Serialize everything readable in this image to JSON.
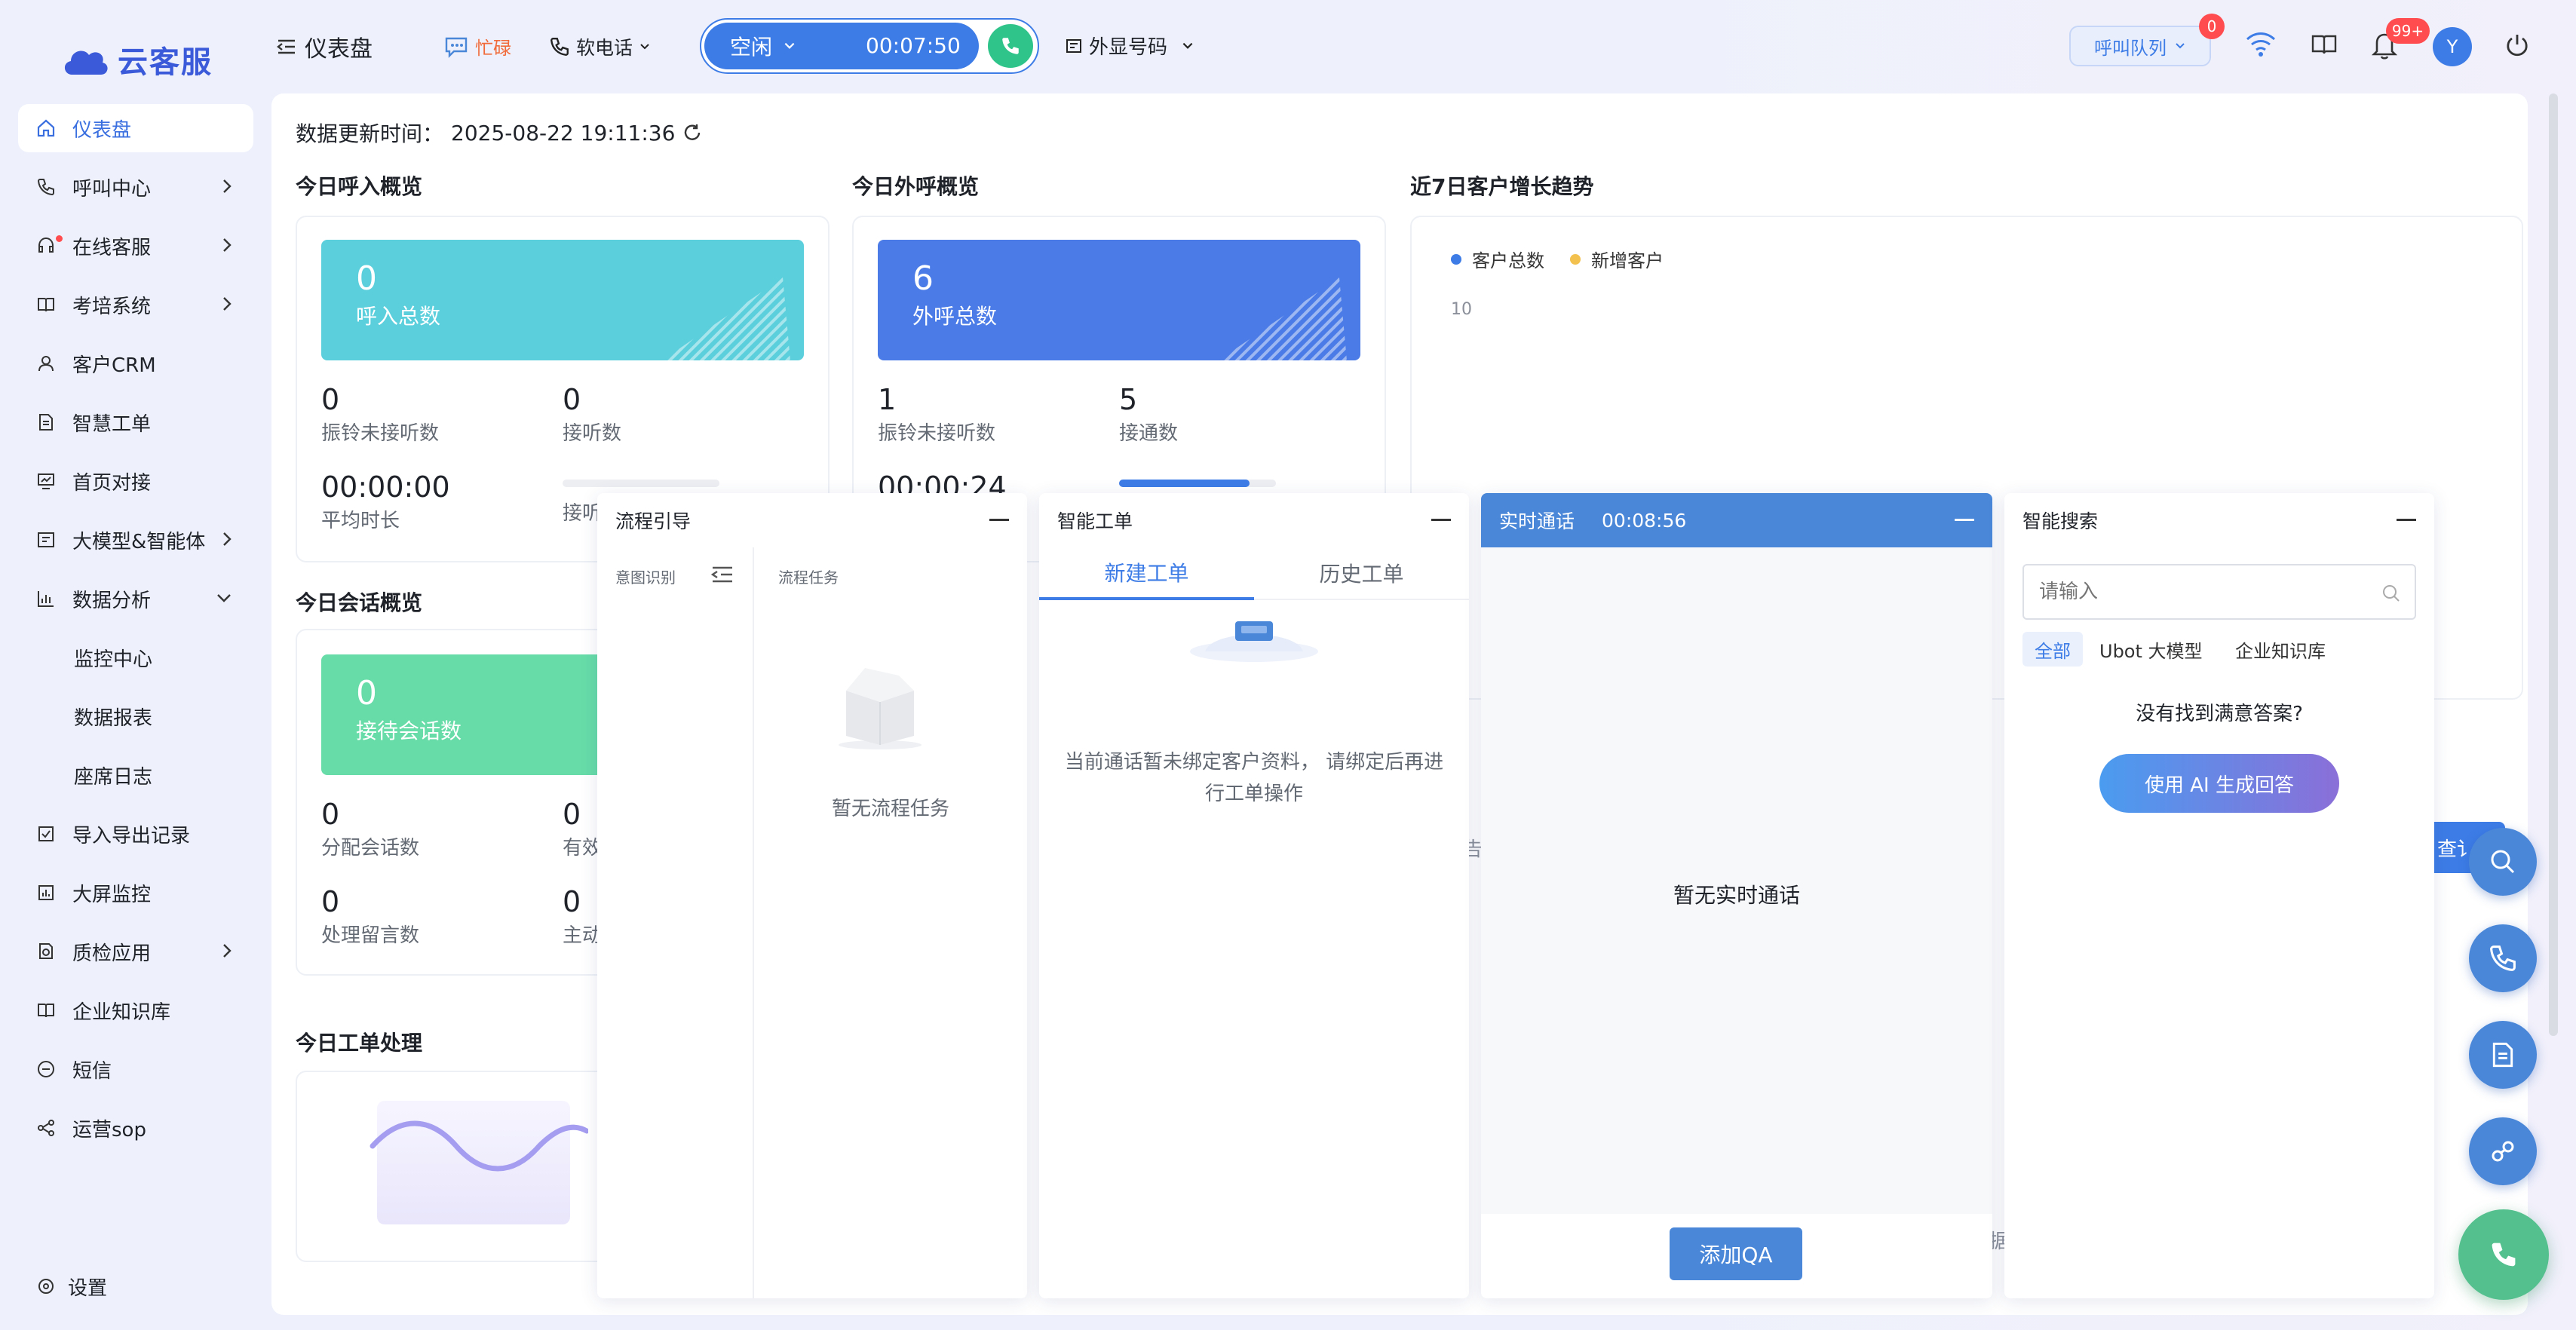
{
  "app": {
    "name": "云客服"
  },
  "header": {
    "title": "仪表盘",
    "busy_label": "忙碌",
    "softphone_label": "软电话",
    "status_label": "空闲",
    "status_timer": "00:07:50",
    "outbound_number_label": "外显号码",
    "queue_label": "呼叫队列",
    "queue_badge": "0",
    "notification_badge": "99+",
    "avatar_initial": "Y"
  },
  "sidebar": {
    "items": [
      {
        "label": "仪表盘"
      },
      {
        "label": "呼叫中心"
      },
      {
        "label": "在线客服"
      },
      {
        "label": "考培系统"
      },
      {
        "label": "客户CRM"
      },
      {
        "label": "智慧工单"
      },
      {
        "label": "首页对接"
      },
      {
        "label": "大模型&智能体"
      },
      {
        "label": "数据分析"
      },
      {
        "label": "监控中心"
      },
      {
        "label": "数据报表"
      },
      {
        "label": "座席日志"
      },
      {
        "label": "导入导出记录"
      },
      {
        "label": "大屏监控"
      },
      {
        "label": "质检应用"
      },
      {
        "label": "企业知识库"
      },
      {
        "label": "短信"
      },
      {
        "label": "运营sop"
      },
      {
        "label": "设置"
      }
    ]
  },
  "dashboard": {
    "update_label": "数据更新时间：",
    "update_time": "2025-08-22 19:11:36",
    "inbound": {
      "title": "今日呼入概览",
      "kpi_value": "0",
      "kpi_label": "呼入总数",
      "stats": [
        {
          "value": "0",
          "label": "振铃未接听数"
        },
        {
          "value": "0",
          "label": "接听数"
        },
        {
          "value": "00:00:00",
          "label": "平均时长"
        },
        {
          "value": "",
          "label": "接听"
        }
      ],
      "answer_rate": 0
    },
    "outbound": {
      "title": "今日外呼概览",
      "kpi_value": "6",
      "kpi_label": "外呼总数",
      "stats": [
        {
          "value": "1",
          "label": "振铃未接听数"
        },
        {
          "value": "5",
          "label": "接通数"
        },
        {
          "value": "00:00:24",
          "label": ""
        }
      ],
      "connect_rate": 0.83
    },
    "trend": {
      "title": "近7日客户增长趋势",
      "legend": [
        {
          "label": "客户总数",
          "color": "#3d7ce6"
        },
        {
          "label": "新增客户",
          "color": "#f2c14e"
        }
      ],
      "y_tick": "10"
    },
    "sessions": {
      "title": "今日会话概览",
      "kpi_value": "0",
      "kpi_label": "接待会话数",
      "stats": [
        {
          "value": "0",
          "label": "分配会话数"
        },
        {
          "value": "0",
          "label": "有效"
        },
        {
          "value": "0",
          "label": "处理留言数"
        },
        {
          "value": "0",
          "label": "主动"
        }
      ]
    },
    "workorders": {
      "title": "今日工单处理"
    },
    "query_button_partial": "查讠",
    "partial_text_1": "告",
    "partial_text_2": "据"
  },
  "panels": {
    "flow": {
      "title": "流程引导",
      "col1": "意图识别",
      "col2": "流程任务",
      "empty": "暂无流程任务"
    },
    "smart_order": {
      "title": "智能工单",
      "tab_new": "新建工单",
      "tab_history": "历史工单",
      "empty": "当前通话暂未绑定客户资料， 请绑定后再进行工单操作"
    },
    "realtime": {
      "title": "实时通话",
      "timer": "00:08:56",
      "empty": "暂无实时通话",
      "add_qa": "添加QA"
    },
    "search": {
      "title": "智能搜索",
      "placeholder": "请输入",
      "tabs": [
        "全部",
        "Ubot 大模型",
        "企业知识库"
      ],
      "not_found": "没有找到满意答案?",
      "ai_button": "使用 AI 生成回答"
    }
  },
  "colors": {
    "primary": "#3d7ce6",
    "inbound_kpi": "#5ccfdc",
    "outbound_kpi": "#4a7be6",
    "session_kpi": "#67dca8",
    "busy": "#f06a3a"
  }
}
